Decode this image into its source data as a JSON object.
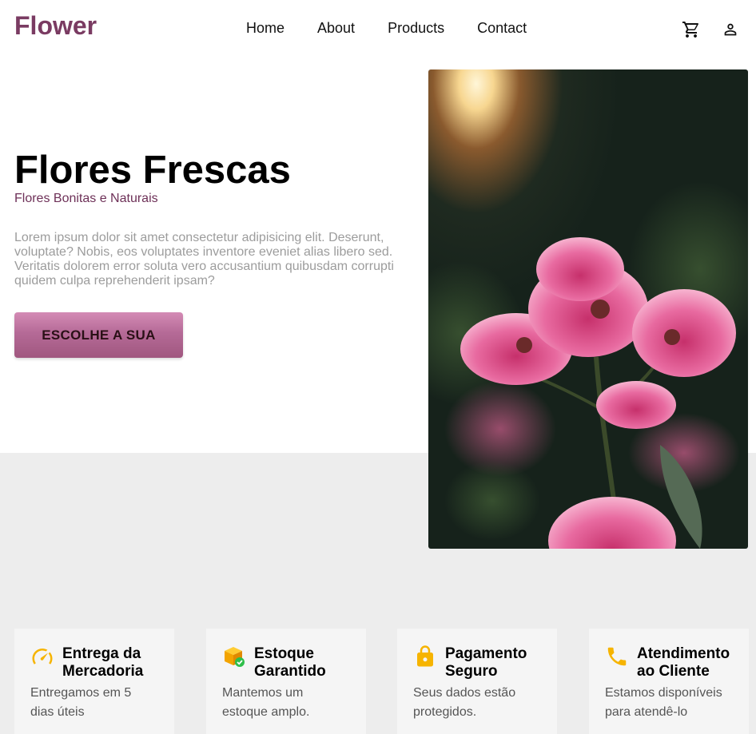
{
  "header": {
    "logo": "Flower",
    "nav": [
      {
        "label": "Home"
      },
      {
        "label": "About"
      },
      {
        "label": "Products"
      },
      {
        "label": "Contact"
      }
    ],
    "icons": [
      "cart-icon",
      "user-icon"
    ]
  },
  "hero": {
    "title": "Flores Frescas",
    "subtitle": "Flores Bonitas e Naturais",
    "description": "Lorem ipsum dolor sit amet consectetur adipisicing elit. Deserunt, voluptate? Nobis, eos voluptates inventore eveniet alias libero sed. Veritatis dolorem error soluta vero accusantium quibusdam corrupti quidem culpa reprehenderit ipsam?",
    "cta_label": "ESCOLHE A SUA",
    "image": "pink-flowers-photo"
  },
  "features": [
    {
      "icon": "speedometer-icon",
      "title": "Entrega da Mercadoria",
      "text": "Entregamos em 5 dias úteis"
    },
    {
      "icon": "box-check-icon",
      "title": "Estoque Garantido",
      "text": "Mantemos um estoque amplo."
    },
    {
      "icon": "lock-icon",
      "title": "Pagamento Seguro",
      "text": "Seus dados estão protegidos."
    },
    {
      "icon": "phone-icon",
      "title": "Atendimento ao Cliente",
      "text": "Estamos disponíveis para atendê-lo"
    }
  ],
  "colors": {
    "brand": "#7a3b62",
    "button": "#b56a97",
    "icon_accent": "#f6b400",
    "band": "#ededed"
  }
}
